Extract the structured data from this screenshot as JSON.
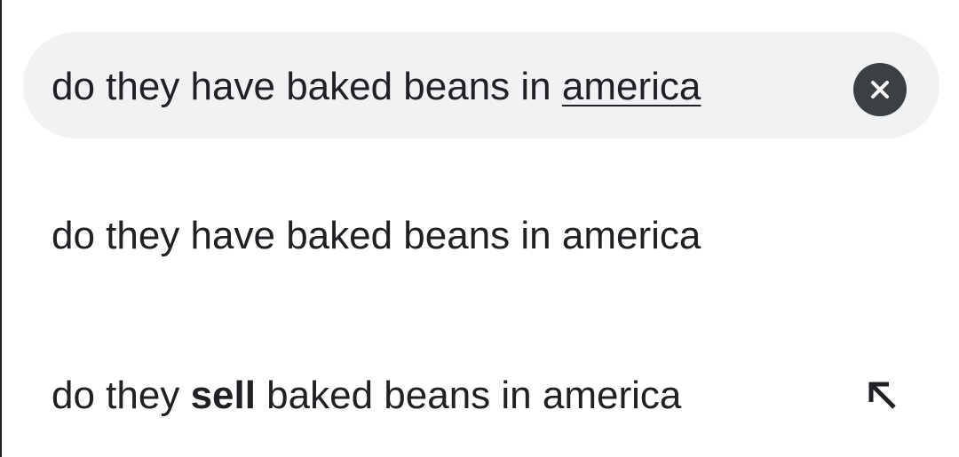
{
  "search": {
    "query_prefix": "do they have baked beans in ",
    "query_composing": "america",
    "clear_icon": "close-icon"
  },
  "suggestions": [
    {
      "parts": [
        "do they have baked beans in america"
      ],
      "action_icon": null
    },
    {
      "parts": [
        "do they ",
        "sell",
        " baked beans in america"
      ],
      "action_icon": "arrow-up-left-icon"
    }
  ],
  "colors": {
    "search_bar_bg": "#f1f2f4",
    "text": "#202124",
    "clear_button_bg": "#3c4043"
  }
}
